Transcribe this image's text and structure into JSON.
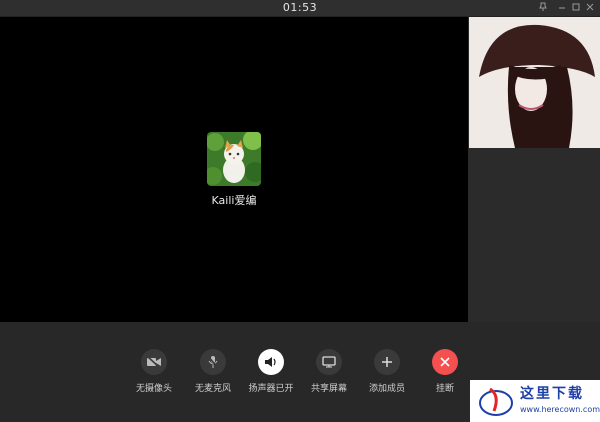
{
  "titlebar": {
    "timer": "01:53",
    "controls": [
      "pin-icon",
      "minimize-icon",
      "maximize-icon",
      "close-icon"
    ]
  },
  "main_video": {
    "username": "Kaili爱编"
  },
  "controls": [
    {
      "id": "camera",
      "label": "无摄像头",
      "icon": "video-off-icon",
      "style": "dark"
    },
    {
      "id": "mic",
      "label": "无麦克风",
      "icon": "mic-off-icon",
      "style": "dark"
    },
    {
      "id": "speaker",
      "label": "扬声器已开",
      "icon": "speaker-icon",
      "style": "white"
    },
    {
      "id": "share",
      "label": "共享屏幕",
      "icon": "monitor-icon",
      "style": "dark"
    },
    {
      "id": "add",
      "label": "添加成员",
      "icon": "plus-icon",
      "style": "dark"
    },
    {
      "id": "hangup",
      "label": "挂断",
      "icon": "close-icon",
      "style": "red"
    }
  ],
  "watermark": {
    "text": "这里下载",
    "url": "www.herecown.com"
  },
  "colors": {
    "background": "#2b2b2b",
    "video": "#000000",
    "hangup": "#f4504f"
  }
}
